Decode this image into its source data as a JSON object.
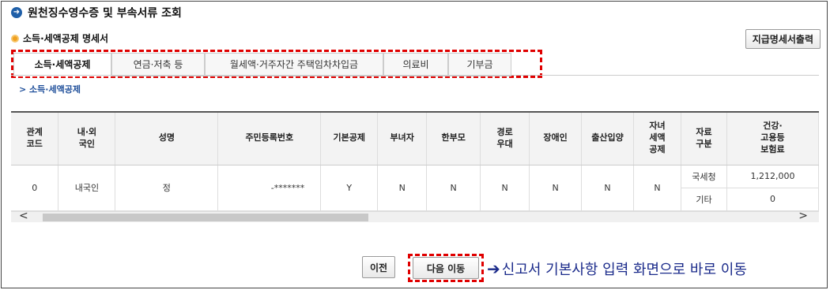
{
  "page": {
    "title": "원천징수영수증 및 부속서류 조회"
  },
  "section": {
    "title": "소득·세액공제 명세서",
    "print_button": "지급명세서출력"
  },
  "tabs": [
    {
      "label": "소득·세액공제"
    },
    {
      "label": "연금·저축 등"
    },
    {
      "label": "월세액·거주자간 주택임차차입금"
    },
    {
      "label": "의료비"
    },
    {
      "label": "기부금"
    }
  ],
  "sublink": "> 소득·세액공제",
  "table": {
    "headers": [
      "관계\n코드",
      "내·외\n국인",
      "성명",
      "주민등록번호",
      "기본공제",
      "부녀자",
      "한부모",
      "경로\n우대",
      "장애인",
      "출산입양",
      "자녀\n세액\n공제",
      "자료\n구분",
      "건강·\n고용등\n보험료"
    ],
    "row": {
      "code": "0",
      "nationality": "내국인",
      "name": "정",
      "rrn": "-*******",
      "basic": "Y",
      "woman": "N",
      "single_parent": "N",
      "elderly": "N",
      "disabled": "N",
      "birth_adopt": "N",
      "child_credit": "N",
      "sources": [
        {
          "type": "국세청",
          "amount": "1,212,000"
        },
        {
          "type": "기타",
          "amount": "0"
        }
      ]
    }
  },
  "nav": {
    "prev": "이전",
    "next": "다음 이동"
  },
  "annotation": {
    "arrow": "➔",
    "text": "신고서 기본사항 입력 화면으로 바로 이동"
  },
  "colors": {
    "accent_red": "#e00000",
    "title_icon": "#1f5fa8",
    "bullet": "#f0a020",
    "annotation": "#1a2a8a"
  }
}
